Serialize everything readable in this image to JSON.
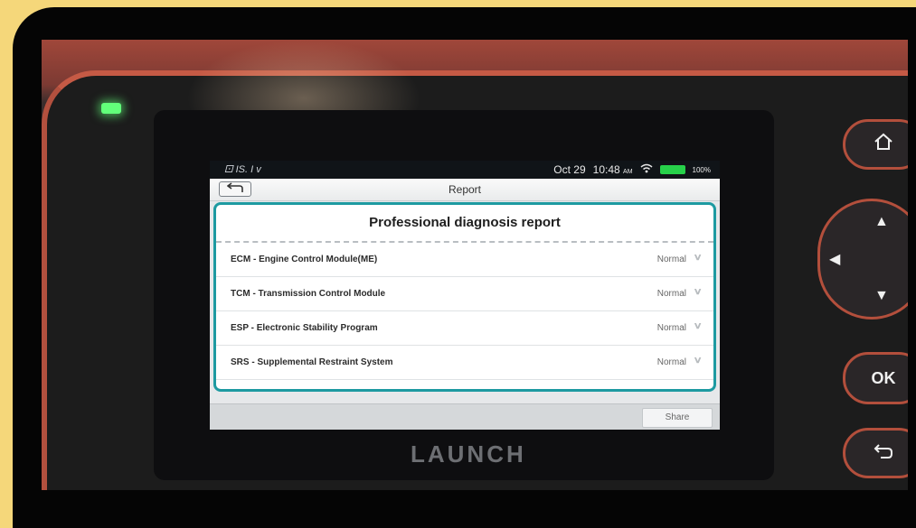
{
  "statusbar": {
    "left_text": "⚀ IS. I v",
    "date": "Oct 29",
    "time": "10:48",
    "ampm": "AM",
    "battery_pct": "100%"
  },
  "header": {
    "title": "Report",
    "back_icon": "back-arrow-icon"
  },
  "report": {
    "title": "Professional diagnosis report",
    "rows": [
      {
        "label": "ECM - Engine Control Module(ME)",
        "status": "Normal"
      },
      {
        "label": "TCM - Transmission Control Module",
        "status": "Normal"
      },
      {
        "label": "ESP - Electronic Stability Program",
        "status": "Normal"
      },
      {
        "label": "SRS - Supplemental Restraint System",
        "status": "Normal"
      }
    ]
  },
  "footer": {
    "share_label": "Share"
  },
  "device": {
    "brand": "LAUNCH",
    "ok_label": "OK",
    "led_color": "#62ff7a",
    "accent_color": "#1d9aa1"
  }
}
